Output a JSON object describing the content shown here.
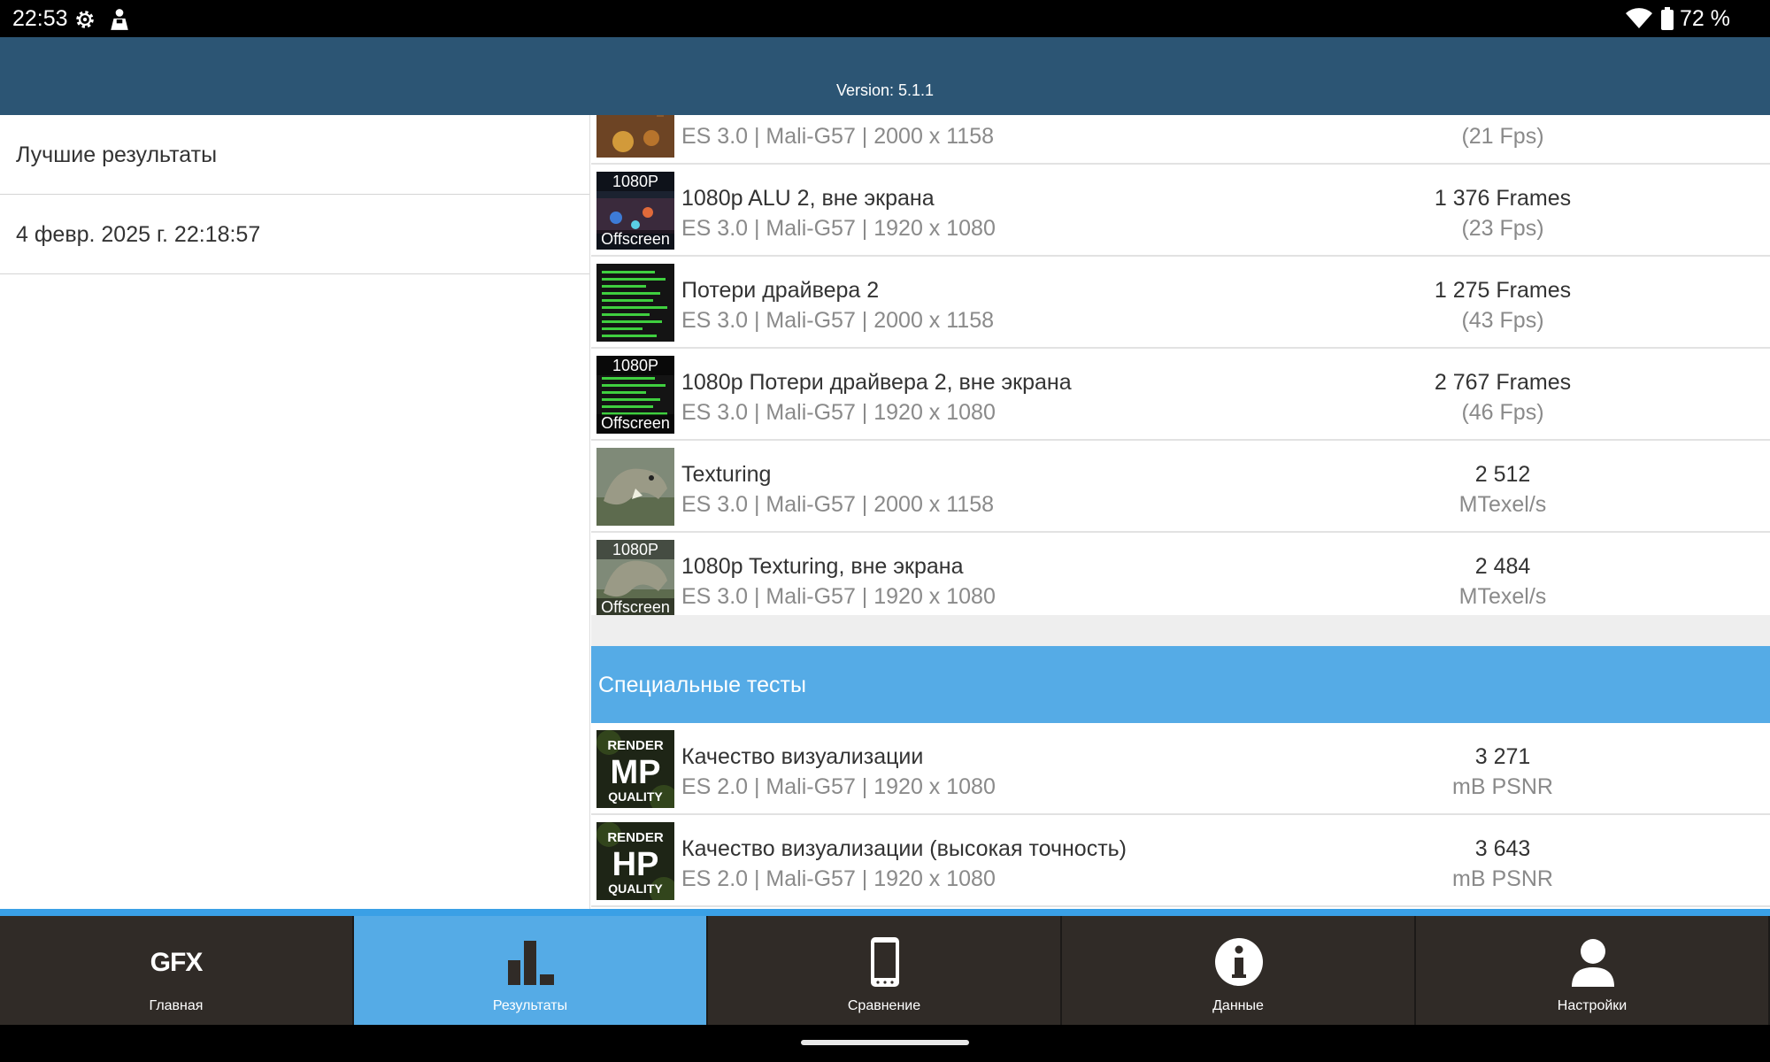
{
  "status_bar": {
    "time": "22:53",
    "battery": "72 %"
  },
  "header": {
    "version": "Version: 5.1.1"
  },
  "left_pane": {
    "items": [
      "Лучшие результаты",
      "4 февр. 2025 г. 22:18:57"
    ]
  },
  "results_top": [
    {
      "name": "",
      "sub": "ES 3.0 | Mali-G57 | 2000 x 1158",
      "value": "",
      "unit": "(21 Fps)",
      "thumb": "alu"
    },
    {
      "name": "1080p ALU 2, вне экрана",
      "sub": "ES 3.0 | Mali-G57 | 1920 x 1080",
      "value": "1 376 Frames",
      "unit": "(23 Fps)",
      "thumb": "alu-offscreen"
    },
    {
      "name": "Потери драйвера 2",
      "sub": "ES 3.0 | Mali-G57 | 2000 x 1158",
      "value": "1 275 Frames",
      "unit": "(43 Fps)",
      "thumb": "driver"
    },
    {
      "name": "1080p Потери драйвера 2, вне экрана",
      "sub": "ES 3.0 | Mali-G57 | 1920 x 1080",
      "value": "2 767 Frames",
      "unit": "(46 Fps)",
      "thumb": "driver-offscreen"
    },
    {
      "name": "Texturing",
      "sub": "ES 3.0 | Mali-G57 | 2000 x 1158",
      "value": "2 512",
      "unit": "MTexel/s",
      "thumb": "texturing"
    },
    {
      "name": "1080p Texturing, вне экрана",
      "sub": "ES 3.0 | Mali-G57 | 1920 x 1080",
      "value": "2 484",
      "unit": "MTexel/s",
      "thumb": "texturing-offscreen"
    }
  ],
  "special_section": {
    "title": "Специальные тесты"
  },
  "results_special": [
    {
      "name": "Качество визуализации",
      "sub": "ES 2.0 | Mali-G57 | 1920 x 1080",
      "value": "3 271",
      "unit": "mB PSNR",
      "thumb": "render-mp"
    },
    {
      "name": "Качество визуализации (высокая точность)",
      "sub": "ES 2.0 | Mali-G57 | 1920 x 1080",
      "value": "3 643",
      "unit": "mB PSNR",
      "thumb": "render-hp"
    }
  ],
  "thumb_labels": {
    "res": "1080P",
    "offscreen": "Offscreen",
    "render": "RENDER",
    "quality": "QUALITY",
    "mp": "MP",
    "hp": "HP"
  },
  "nav": {
    "logo": "GFX",
    "items": [
      {
        "label": "Главная",
        "icon": "gfx-logo"
      },
      {
        "label": "Результаты",
        "icon": "bar-chart-icon",
        "active": true
      },
      {
        "label": "Сравнение",
        "icon": "phone-icon"
      },
      {
        "label": "Данные",
        "icon": "info-icon"
      },
      {
        "label": "Настройки",
        "icon": "person-icon"
      }
    ]
  },
  "colors": {
    "header": "#2c5574",
    "accent": "#55abe6",
    "nav": "#302b27"
  }
}
